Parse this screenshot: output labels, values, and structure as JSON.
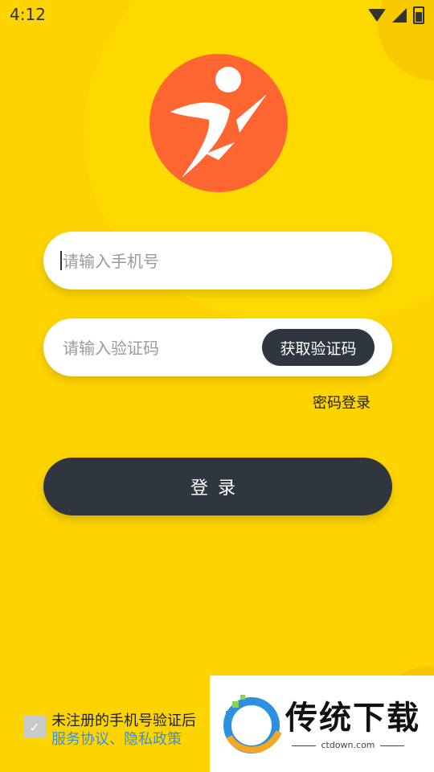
{
  "status_bar": {
    "time": "4:12"
  },
  "icons": {
    "wifi": "wifi-icon",
    "signal": "signal-icon",
    "battery": "battery-charging-icon",
    "logo": "runner-logo-icon",
    "check": "check-icon"
  },
  "colors": {
    "background": "#FDD300",
    "logo_circle": "#FF6531",
    "dark_button": "#2F3640",
    "link": "#3A8FD8"
  },
  "form": {
    "phone_placeholder": "请输入手机号",
    "code_placeholder": "请输入验证码",
    "get_code_label": "获取验证码",
    "password_login_label": "密码登录",
    "login_label": "登录"
  },
  "agreement": {
    "text": "未注册的手机号验证后",
    "links": "服务协议、隐私政策",
    "checked": true
  },
  "watermark": {
    "title": "传统下载",
    "url": "ctdown.com"
  }
}
